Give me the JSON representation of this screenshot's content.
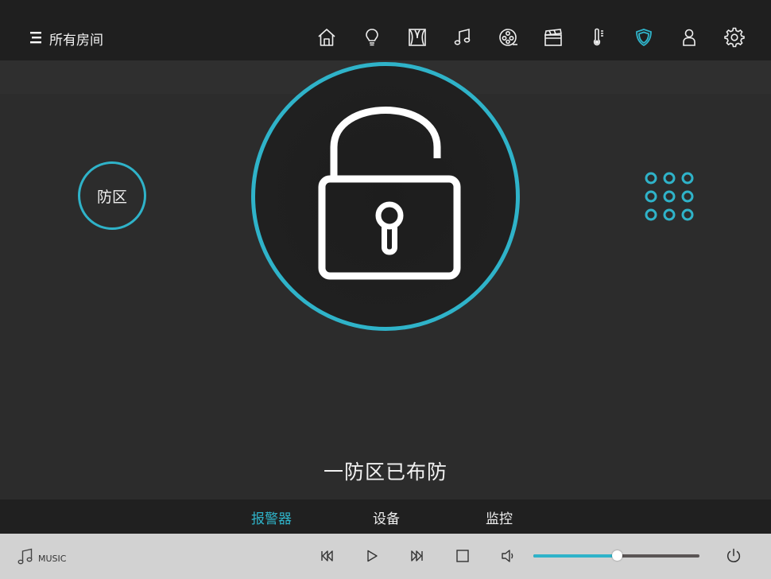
{
  "header": {
    "menu_icon": "menu-icon",
    "title": "所有房间",
    "nav_icons": [
      "home-icon",
      "bulb-icon",
      "curtain-icon",
      "music-note-icon",
      "film-reel-icon",
      "clapperboard-icon",
      "thermometer-icon",
      "shield-icon",
      "user-icon",
      "gear-icon"
    ],
    "active_nav": "shield-icon"
  },
  "security": {
    "zone_button": "防区",
    "lock_icon": "unlocked-padlock-icon",
    "keypad_icon": "keypad-icon",
    "status": "一防区已布防"
  },
  "tabs": [
    {
      "label": "报警器",
      "active": true
    },
    {
      "label": "设备",
      "active": false
    },
    {
      "label": "监控",
      "active": false
    }
  ],
  "player": {
    "music_label": "MUSIC",
    "controls": [
      "previous-icon",
      "play-icon",
      "next-icon",
      "stop-icon",
      "volume-icon",
      "power-icon"
    ],
    "volume_level": 0.5
  },
  "colors": {
    "accent": "#2fb3c9",
    "top_bar": "#1f1f1f",
    "background": "#2c2c2c",
    "player_bar": "#d2d2d2"
  }
}
